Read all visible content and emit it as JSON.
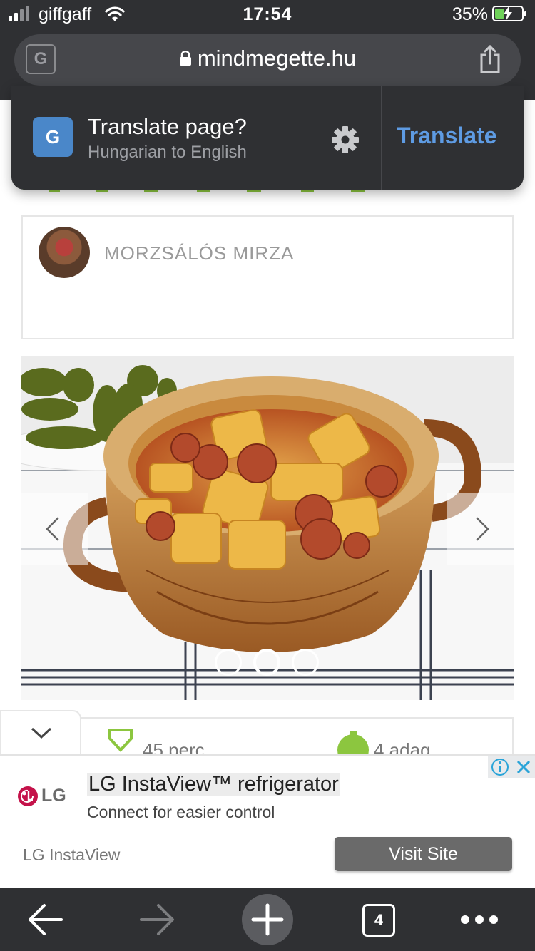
{
  "status_bar": {
    "carrier": "giffgaff",
    "time": "17:54",
    "battery_percent": "35%",
    "battery_level": 0.35
  },
  "url_bar": {
    "domain": "mindmegette.hu"
  },
  "translate_prompt": {
    "title": "Translate page?",
    "subtitle": "Hungarian to English",
    "action_label": "Translate"
  },
  "recipe": {
    "author_name": "MORZSÁLÓS MIRZA",
    "cook_time": "45 perc",
    "servings": "4 adag",
    "gallery_slide_count": 3,
    "gallery_active_index": 1
  },
  "ad": {
    "logo_text": "LG",
    "headline": "LG InstaView™ refrigerator",
    "subtext": "Connect for easier control",
    "advertiser": "LG InstaView",
    "cta_label": "Visit Site"
  },
  "toolbar": {
    "tab_count": "4"
  },
  "colors": {
    "chrome_dark": "#2f3033",
    "translate_accent": "#5e9be3",
    "recipe_green": "#8cc63f"
  }
}
